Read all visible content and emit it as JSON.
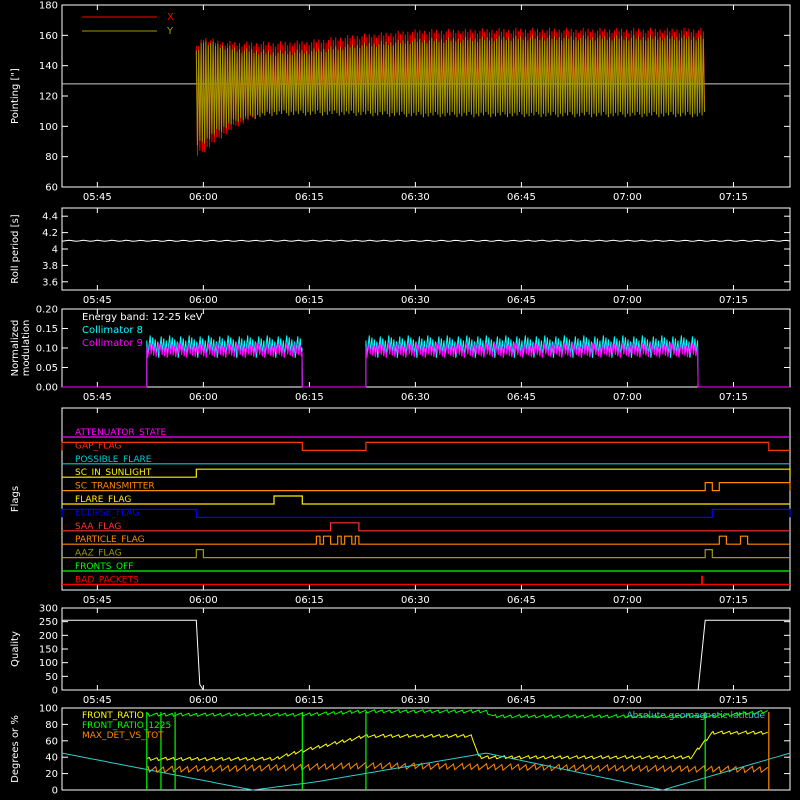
{
  "chart_data": [
    {
      "id": "pointing",
      "type": "line",
      "ylabel": "Pointing [\"]",
      "ylim": [
        60,
        180
      ],
      "yticks": [
        60,
        80,
        100,
        120,
        140,
        160,
        180
      ],
      "xlim": [
        "05:40",
        "07:23"
      ],
      "xticks": [
        "05:45",
        "06:00",
        "06:15",
        "06:30",
        "06:45",
        "07:00",
        "07:15"
      ],
      "reference_line": 128,
      "legend_placement": "top-left",
      "series": [
        {
          "name": "X",
          "color": "#ff0000",
          "x": [
            "05:59",
            "06:00",
            "06:02",
            "06:05",
            "06:10",
            "06:15",
            "06:20",
            "06:30",
            "06:45",
            "07:00",
            "07:11"
          ],
          "min": [
            79,
            82,
            90,
            100,
            110,
            111,
            112,
            112,
            112,
            112,
            112
          ],
          "max": [
            153,
            160,
            157,
            156,
            156,
            157,
            160,
            164,
            165,
            165,
            165
          ]
        },
        {
          "name": "Y",
          "color": "#a09a00",
          "x": [
            "05:59",
            "06:00",
            "06:02",
            "06:05",
            "06:10",
            "06:15",
            "06:20",
            "06:30",
            "06:45",
            "07:00",
            "07:11"
          ],
          "min": [
            86,
            88,
            95,
            103,
            107,
            107,
            107,
            106,
            106,
            106,
            106
          ],
          "max": [
            150,
            158,
            155,
            152,
            150,
            151,
            154,
            158,
            160,
            160,
            160
          ]
        }
      ]
    },
    {
      "id": "roll",
      "type": "line",
      "ylabel": "Roll period [s]",
      "ylim": [
        3.5,
        4.5
      ],
      "yticks": [
        3.6,
        3.8,
        4.0,
        4.2,
        4.4
      ],
      "xticks": [
        "05:45",
        "06:00",
        "06:15",
        "06:30",
        "06:45",
        "07:00",
        "07:15"
      ],
      "series": [
        {
          "name": "",
          "color": "#ffffff",
          "x": [
            "05:40",
            "07:23"
          ],
          "y": [
            4.1,
            4.1
          ]
        }
      ]
    },
    {
      "id": "modulation",
      "type": "line",
      "ylabel": "Normalized modulation",
      "ylim": [
        0,
        0.2
      ],
      "yticks": [
        "0.00",
        "0.05",
        "0.10",
        "0.15",
        "0.20"
      ],
      "xticks": [
        "05:45",
        "06:00",
        "06:15",
        "06:30",
        "06:45",
        "07:00",
        "07:15"
      ],
      "annotation": "Energy band: 12-25 keV",
      "legend_placement": "top-left",
      "active_intervals": [
        [
          "05:52",
          "06:14"
        ],
        [
          "06:23",
          "07:10"
        ]
      ],
      "series": [
        {
          "name": "Collimator 8",
          "color": "#00ffff",
          "level": 0.105,
          "spread": 0.03
        },
        {
          "name": "Collimator 9",
          "color": "#ff00ff",
          "level": 0.095,
          "spread": 0.02
        }
      ]
    },
    {
      "id": "flags",
      "type": "line",
      "ylabel": "Flags",
      "xticks": [
        "05:45",
        "06:00",
        "06:15",
        "06:30",
        "06:45",
        "07:00",
        "07:15"
      ],
      "flags": [
        {
          "name": "ATTENUATOR_STATE",
          "color": "#ff00ff",
          "on": []
        },
        {
          "name": "GAP_FLAG",
          "color": "#ff3300",
          "on": [
            [
              "05:40",
              "06:14"
            ],
            [
              "06:23",
              "07:20"
            ]
          ]
        },
        {
          "name": "POSSIBLE_FLARE",
          "color": "#00cccc",
          "on": []
        },
        {
          "name": "SC_IN_SUNLIGHT",
          "color": "#ffee00",
          "on": [
            [
              "05:59",
              "07:23"
            ]
          ]
        },
        {
          "name": "SC_TRANSMITTER",
          "color": "#ff8800",
          "on": [
            [
              "07:11",
              "07:12"
            ],
            [
              "07:13",
              "07:23"
            ]
          ]
        },
        {
          "name": "FLARE_FLAG",
          "color": "#ffee00",
          "on": [
            [
              "06:10",
              "06:14"
            ]
          ]
        },
        {
          "name": "ECLIPSE_FLAG",
          "color": "#0000ff",
          "on": [
            [
              "05:40",
              "05:59"
            ],
            [
              "07:12",
              "07:23"
            ]
          ]
        },
        {
          "name": "SAA_FLAG",
          "color": "#ff3333",
          "on": [
            [
              "06:18",
              "06:22"
            ]
          ]
        },
        {
          "name": "PARTICLE_FLAG",
          "color": "#ff8800",
          "on": [
            [
              "06:16",
              "06:16.5"
            ],
            [
              "06:17",
              "06:18"
            ],
            [
              "06:19",
              "06:19.5"
            ],
            [
              "06:20",
              "06:21"
            ],
            [
              "06:21.5",
              "06:22"
            ],
            [
              "07:13",
              "07:14"
            ],
            [
              "07:16",
              "07:17"
            ]
          ]
        },
        {
          "name": "AAZ_FLAG",
          "color": "#a09a00",
          "on": [
            [
              "05:59",
              "06:00"
            ],
            [
              "07:11",
              "07:12"
            ]
          ]
        },
        {
          "name": "FRONTS_OFF",
          "color": "#00ff00",
          "on": []
        },
        {
          "name": "BAD_PACKETS",
          "color": "#ff0000",
          "on": [
            [
              "07:10.5",
              "07:10.6"
            ]
          ]
        }
      ]
    },
    {
      "id": "quality",
      "type": "line",
      "ylabel": "Quality",
      "ylim": [
        0,
        300
      ],
      "yticks": [
        0,
        50,
        100,
        150,
        200,
        250,
        300
      ],
      "xticks": [
        "05:45",
        "06:00",
        "06:15",
        "06:30",
        "06:45",
        "07:00",
        "07:15"
      ],
      "series": [
        {
          "name": "",
          "color": "#ffffff",
          "x": [
            "05:40",
            "05:59",
            "05:59.5",
            "06:00",
            "07:10",
            "07:11",
            "07:23"
          ],
          "y": [
            255,
            255,
            20,
            0,
            0,
            255,
            255
          ]
        }
      ]
    },
    {
      "id": "ratios",
      "type": "line",
      "ylabel": "Degrees or %",
      "ylim": [
        0,
        100
      ],
      "yticks": [
        0,
        20,
        40,
        60,
        80,
        100
      ],
      "legend_placement": "top-left",
      "series": [
        {
          "name": "FRONT_RATIO",
          "color": "#ffff00",
          "x": [
            "05:52",
            "06:10",
            "06:14",
            "06:23",
            "06:38",
            "06:39",
            "07:09",
            "07:12",
            "07:20"
          ],
          "y": [
            38,
            38,
            48,
            66,
            66,
            40,
            40,
            70,
            70
          ]
        },
        {
          "name": "FRONT_RATIO_1225",
          "color": "#00ff00",
          "x": [
            "05:52",
            "06:14",
            "06:23",
            "06:40",
            "06:41",
            "07:12",
            "07:20"
          ],
          "y": [
            92,
            92,
            96,
            96,
            90,
            90,
            96
          ]
        },
        {
          "name": "MAX_DET_VS_TOT",
          "color": "#ff8800",
          "x": [
            "05:52",
            "06:14",
            "06:23",
            "07:20"
          ],
          "y": [
            25,
            28,
            30,
            25
          ]
        },
        {
          "name": "Absolute geomagnetic latitude",
          "color": "#33cccc",
          "x": [
            "05:40",
            "06:07",
            "06:16",
            "06:40",
            "07:05",
            "07:23"
          ],
          "y": [
            45,
            0,
            10,
            45,
            0,
            45
          ]
        }
      ]
    }
  ]
}
